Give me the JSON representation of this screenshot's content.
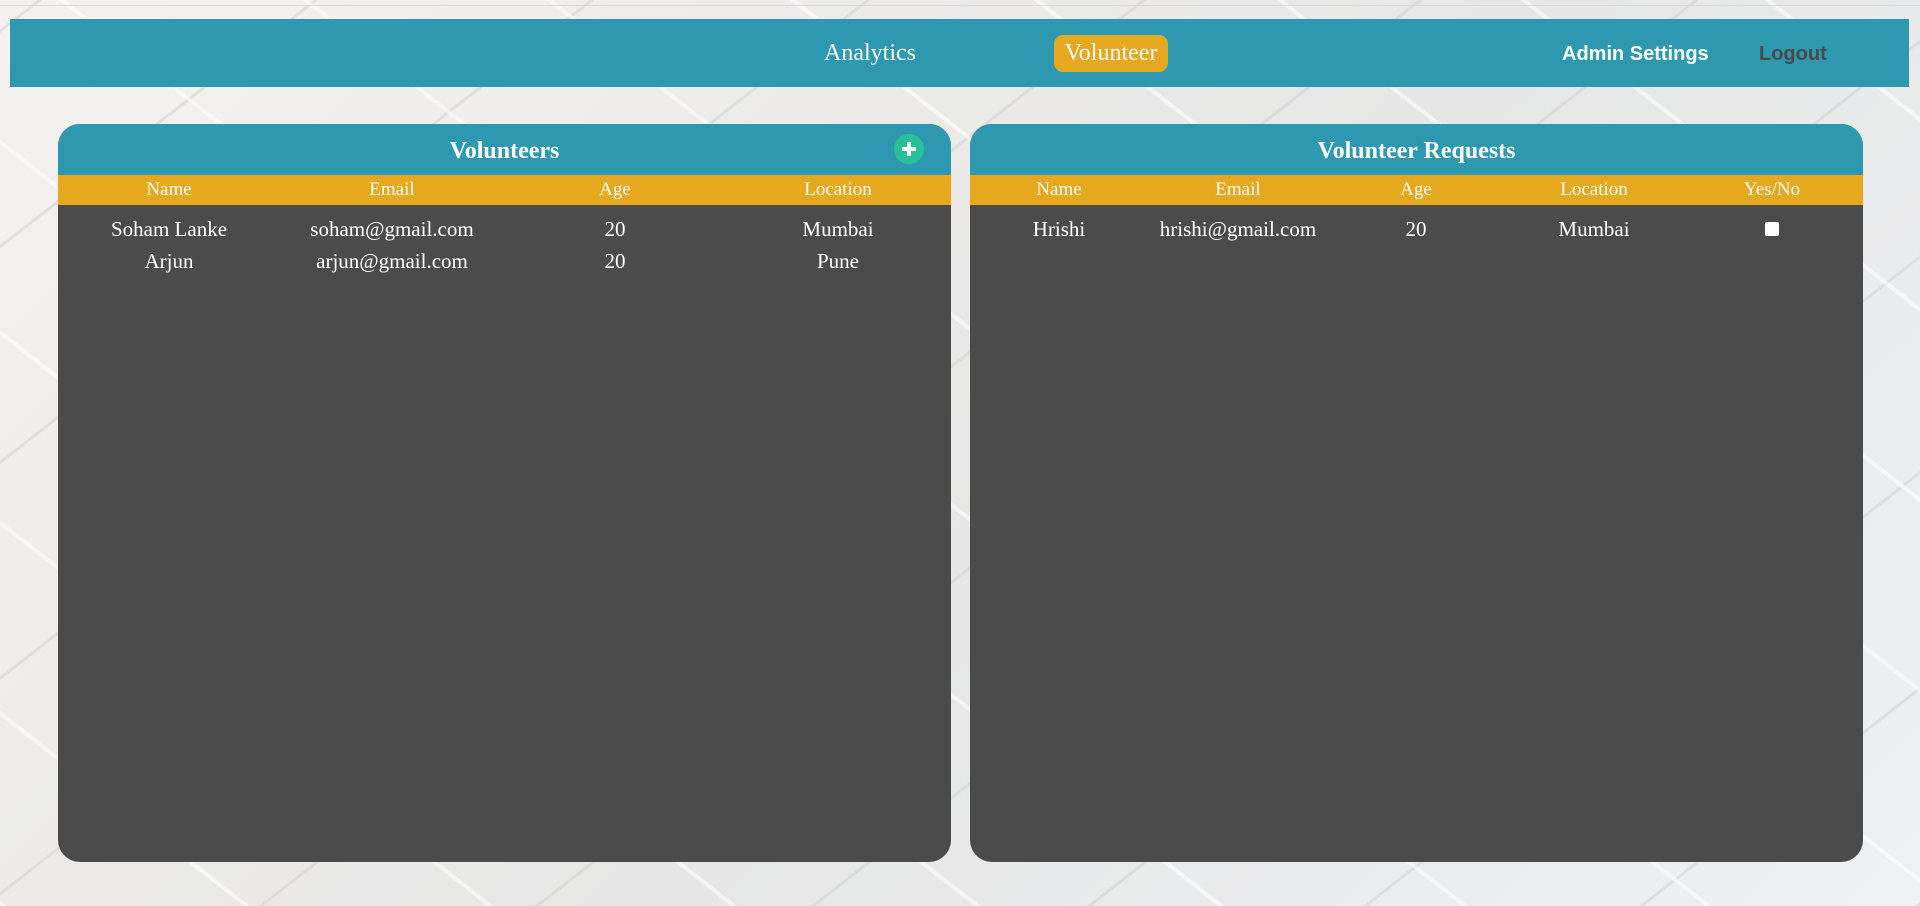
{
  "nav": {
    "analytics": "Analytics",
    "volunteer": "Volunteer",
    "admin_settings": "Admin Settings",
    "logout": "Logout"
  },
  "volunteers_panel": {
    "title": "Volunteers",
    "add_icon": "plus-circle-icon",
    "columns": [
      "Name",
      "Email",
      "Age",
      "Location"
    ],
    "rows": [
      {
        "name": "Soham Lanke",
        "email": "soham@gmail.com",
        "age": "20",
        "location": "Mumbai"
      },
      {
        "name": "Arjun",
        "email": "arjun@gmail.com",
        "age": "20",
        "location": "Pune"
      }
    ]
  },
  "requests_panel": {
    "title": "Volunteer Requests",
    "columns": [
      "Name",
      "Email",
      "Age",
      "Location",
      "Yes/No"
    ],
    "rows": [
      {
        "name": "Hrishi",
        "email": "hrishi@gmail.com",
        "age": "20",
        "location": "Mumbai",
        "approved": false
      }
    ]
  },
  "colors": {
    "navbar": "#2e98b0",
    "accent": "#e6a81e",
    "panel_body": "#4b4b4b",
    "add_button": "#2bbf99"
  }
}
